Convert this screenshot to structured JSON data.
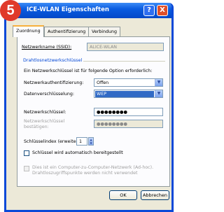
{
  "step_number": "5",
  "window": {
    "title": "ICE-WLAN Eigenschaften",
    "help_button": "?",
    "close_button": "X"
  },
  "tabs": [
    {
      "label": "Zuordnung",
      "active": true
    },
    {
      "label": "Authentifizierung",
      "active": false
    },
    {
      "label": "Verbindung",
      "active": false
    }
  ],
  "ssid": {
    "label": "Netzwerkname (SSID):",
    "value": "ALICE-WLAN"
  },
  "group": {
    "title": "Drahtlosnetzwerkschlüssel"
  },
  "key_info": "Ein Netzwerkschlüssel ist für folgende Option erforderlich:",
  "auth": {
    "label": "Netzwerkauthentifizierung:",
    "value": "Offen"
  },
  "encryption": {
    "label": "Datenverschlüsselung:",
    "value": "WEP"
  },
  "network_key": {
    "label": "Netzwerkschlüssel:",
    "value": "●●●●●●●●"
  },
  "confirm_key": {
    "label_line1": "Netzwerkschlüssel",
    "label_line2": "bestätigen:",
    "value": "●●●●●●●●"
  },
  "key_index": {
    "label": "Schlüsselindex (erweitert):",
    "value": "1"
  },
  "auto_key": {
    "label": "Schlüssel wird automatisch bereitgestellt",
    "checked": false
  },
  "adhoc": {
    "label_line1": "Dies ist ein Computer-zu-Computer-Netzwerk (Ad-hoc).",
    "label_line2": "Drahtloszugriffspunkte werden nicht verwendet",
    "checked": false,
    "enabled": false
  },
  "buttons": {
    "ok": "OK",
    "cancel": "Abbrechen"
  },
  "colors": {
    "titlebar": "#0a5ce0",
    "badge": "#e03a2a",
    "selection": "#316ac5",
    "group_title": "#0046d5"
  }
}
